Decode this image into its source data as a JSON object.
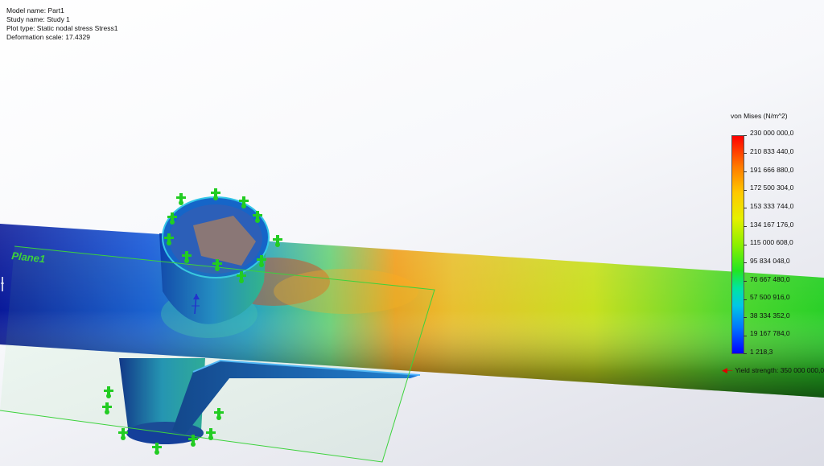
{
  "info": {
    "model_name": "Model name: Part1",
    "study_name": "Study name: Study 1",
    "plot_type": "Plot type: Static nodal stress Stress1",
    "deformation_scale": "Deformation scale: 17.4329"
  },
  "plane_label": "Plane1",
  "legend": {
    "title": "von Mises (N/m^2)",
    "ticks": [
      "230 000 000,0",
      "210 833 440,0",
      "191 666 880,0",
      "172 500 304,0",
      "153 333 744,0",
      "134 167 176,0",
      "115 000 608,0",
      "95 834 048,0",
      "76 667 480,0",
      "57 500 916,0",
      "38 334 352,0",
      "19 167 784,0",
      "1 218,3"
    ],
    "yield": "Yield strength: 350 000 000,0"
  },
  "colors": {
    "max": "#ff0000",
    "min": "#0000ff",
    "fixture": "#22cc22",
    "plane": "#3cd23c",
    "yield_arrow": "#e00000"
  }
}
